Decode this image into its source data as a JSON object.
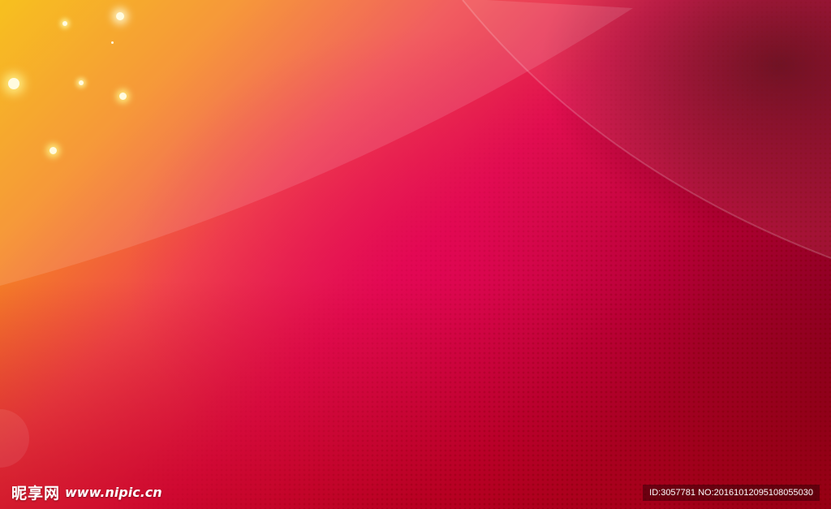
{
  "image": {
    "description_colors": {
      "yellow": "#f6b800",
      "orange": "#f58a1f",
      "pink": "#f0484a",
      "crimson": "#e0104e",
      "deep_red": "#b00032",
      "maroon": "#6a0014"
    }
  },
  "watermark": {
    "logo_text": "昵享网",
    "url": "www.nipic.cn",
    "id_text": "ID:3057781 NO:20161012095108055030"
  }
}
